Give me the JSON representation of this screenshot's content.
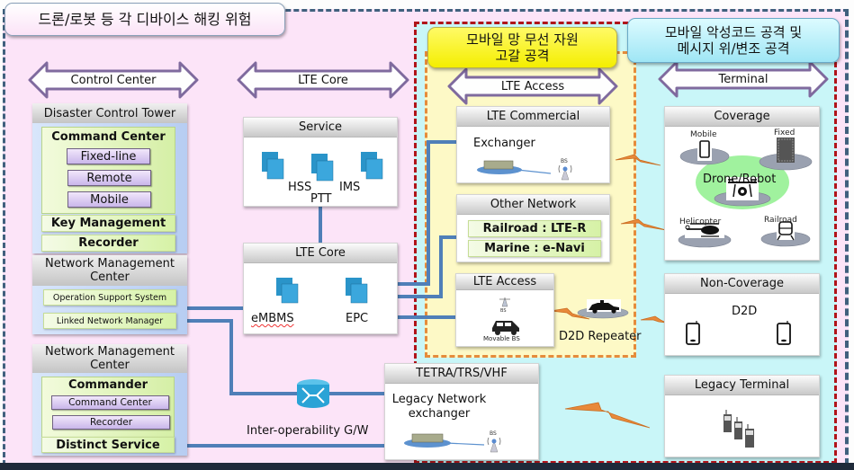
{
  "callouts": {
    "device_hacking": "드론/로봇 등 각 디바이스 해킹 위험",
    "radio_resource_line1": "모바일 망 무선 자원",
    "radio_resource_line2": "고갈 공격",
    "malicious_code_line1": "모바일 악성코드 공격 및",
    "malicious_code_line2": "메시지 위/변조 공격"
  },
  "section_arrows": {
    "control_center": "Control Center",
    "lte_core": "LTE Core",
    "lte_access": "LTE Access",
    "terminal": "Terminal"
  },
  "disaster_control_tower": {
    "title": "Disaster Control Tower",
    "command_center": "Command Center",
    "buttons": [
      "Fixed-line",
      "Remote",
      "Mobile"
    ],
    "key_management": "Key Management",
    "recorder": "Recorder"
  },
  "network_management_center_1": {
    "title_line1": "Network Management",
    "title_line2": "Center",
    "items": [
      "Operation Support System",
      "Linked Network Manager"
    ]
  },
  "network_management_center_2": {
    "title_line1": "Network Management",
    "title_line2": "Center",
    "commander": "Commander",
    "buttons": [
      "Command Center",
      "Recorder"
    ],
    "distinct_service": "Distinct Service"
  },
  "service_panel": {
    "title": "Service",
    "labels": [
      "HSS",
      "IMS",
      "PTT"
    ]
  },
  "lte_core_panel": {
    "title": "LTE Core",
    "labels": [
      "eMBMS",
      "EPC"
    ]
  },
  "gateway": {
    "label": "Inter-operability G/W"
  },
  "lte_commercial": {
    "title": "LTE Commercial",
    "exchanger": "Exchanger",
    "bs": "BS"
  },
  "other_network": {
    "title": "Other Network",
    "items": [
      "Railroad : LTE-R",
      "Marine : e-Navi"
    ]
  },
  "lte_access_panel": {
    "title": "LTE Access",
    "bs": "BS",
    "movable_bs": "Movable BS"
  },
  "d2d_repeater": {
    "label": "D2D Repeater"
  },
  "tetra": {
    "title": "TETRA/TRS/VHF",
    "label_line1": "Legacy Network",
    "label_line2": "exchanger",
    "bs": "BS"
  },
  "coverage": {
    "title": "Coverage",
    "mobile": "Mobile",
    "fixed": "Fixed",
    "drone_robot": "Drone/Robot",
    "helicopter": "Helicopter",
    "railroad": "Railroad"
  },
  "non_coverage": {
    "title": "Non-Coverage",
    "d2d": "D2D"
  },
  "legacy_terminal": {
    "title": "Legacy Terminal"
  },
  "colors": {
    "outer_zone": "#fce4f8",
    "red_zone": "#c9f6f8",
    "orange_zone": "#fdf9c6",
    "connector": "#4f7fb8",
    "arrow_stroke": "#7f6a9e",
    "lightning": "#e8893a"
  }
}
